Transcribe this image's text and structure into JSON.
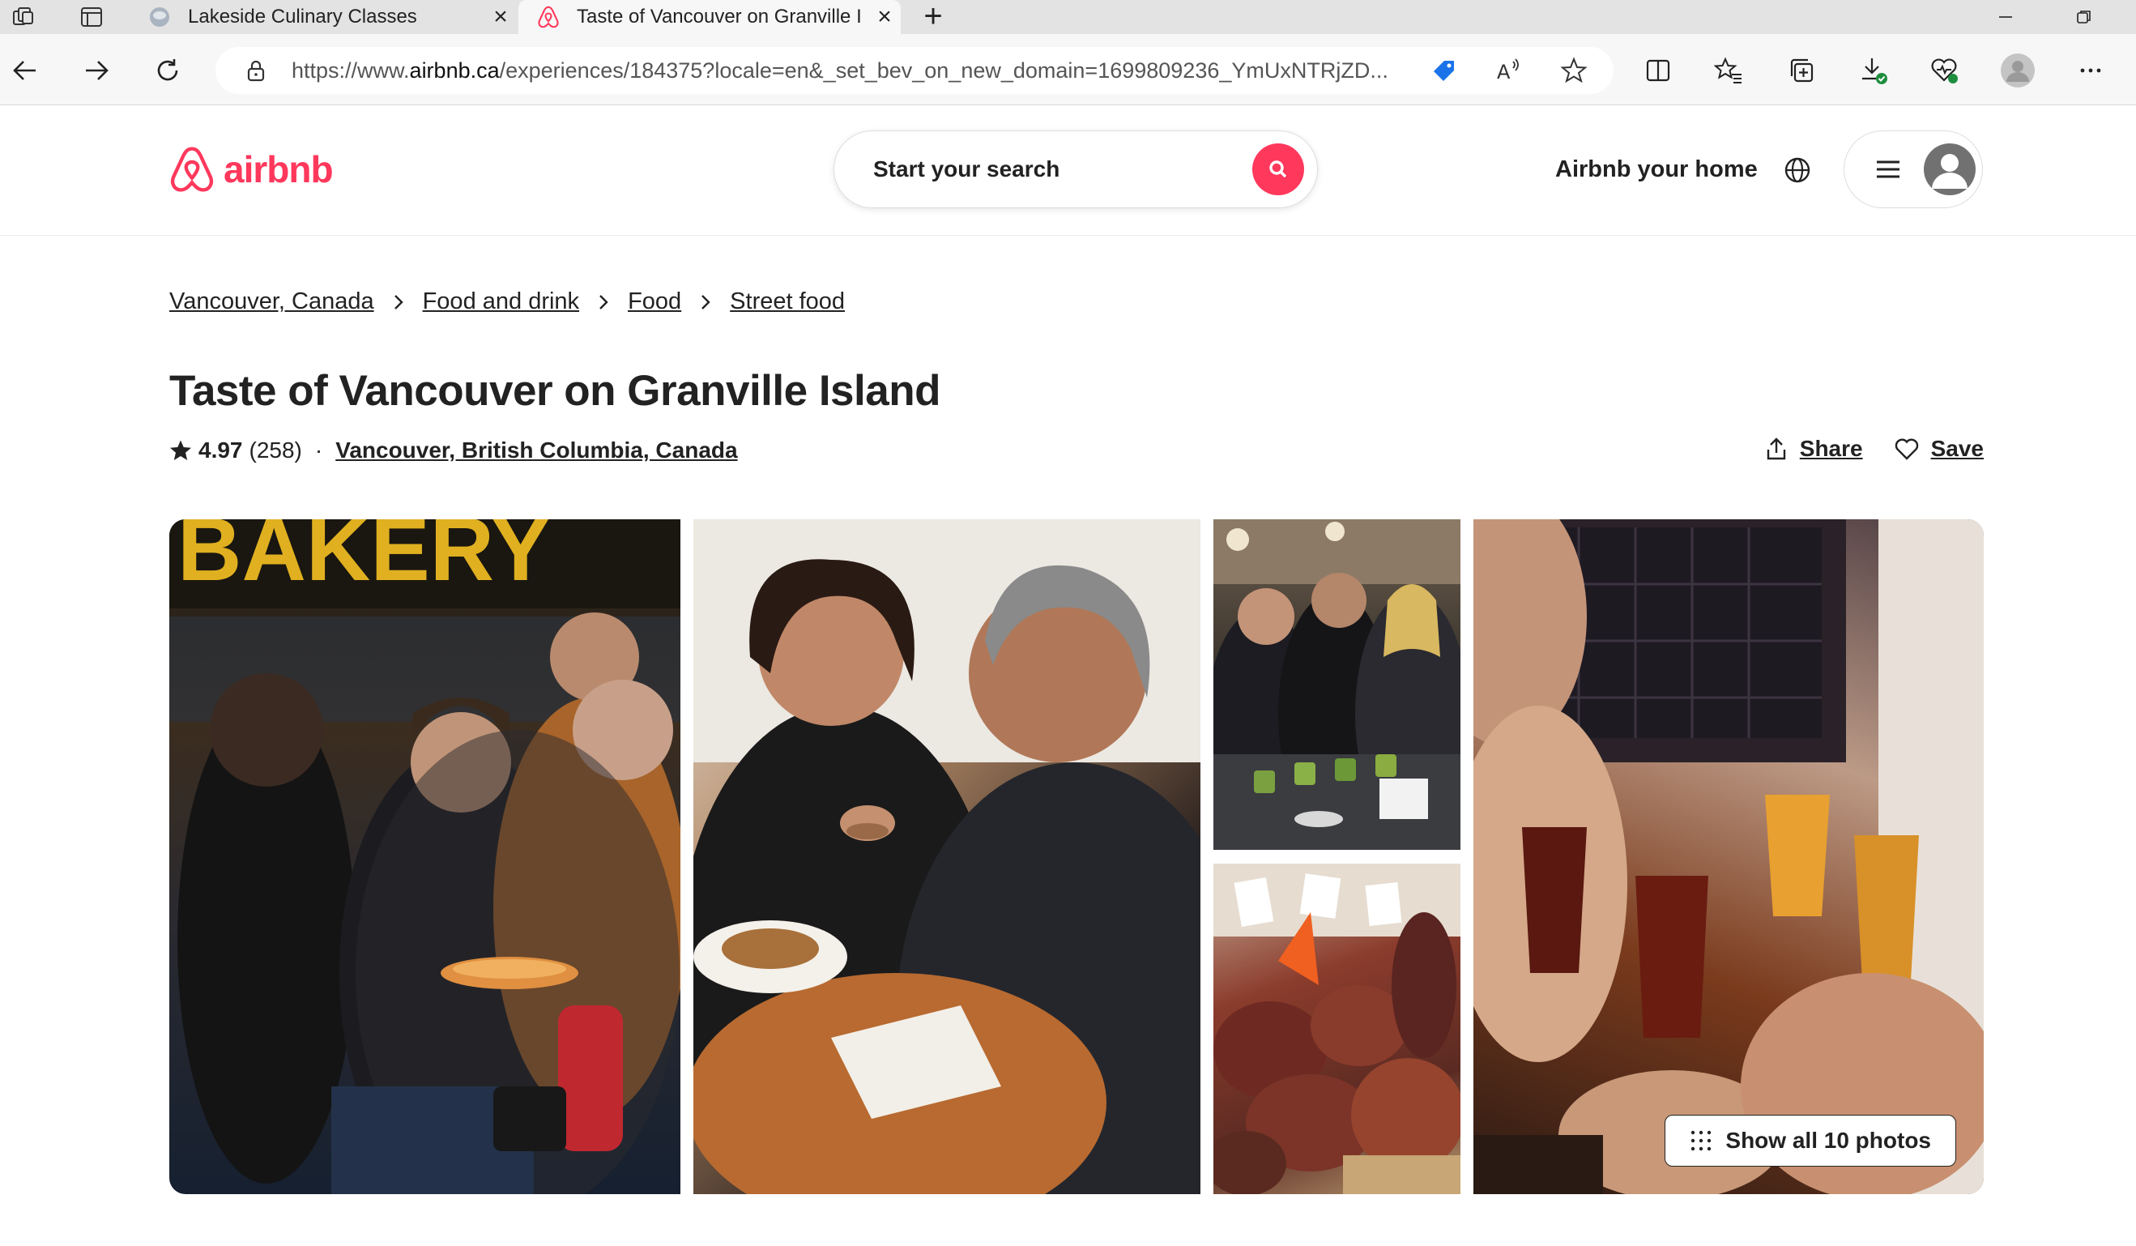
{
  "browser": {
    "tabs": [
      {
        "title": "Lakeside Culinary Classes",
        "active": false
      },
      {
        "title": "Taste of Vancouver on Granville I",
        "active": true
      }
    ],
    "url_prefix": "https://www.",
    "url_domain": "airbnb.ca",
    "url_rest": "/experiences/184375?locale=en&_set_bev_on_new_domain=1699809236_YmUxNTRjZD..."
  },
  "header": {
    "logo_text": "airbnb",
    "search_label": "Start your search",
    "host_link": "Airbnb your home",
    "brand_color": "#ff385c"
  },
  "breadcrumb": [
    "Vancouver, Canada",
    "Food and drink",
    "Food",
    "Street food"
  ],
  "listing": {
    "title": "Taste of Vancouver on Granville Island",
    "rating": "4.97",
    "review_count": "(258)",
    "separator": "·",
    "location": "Vancouver, British Columbia, Canada",
    "share_label": "Share",
    "save_label": "Save"
  },
  "gallery": {
    "show_all_label": "Show all 10 photos",
    "photo_subjects": [
      "people sampling pastries outside a bakery",
      "woman and man eating at a table",
      "group tasting pickles",
      "cured meats and sausages display",
      "friends toasting with beer glasses"
    ]
  }
}
